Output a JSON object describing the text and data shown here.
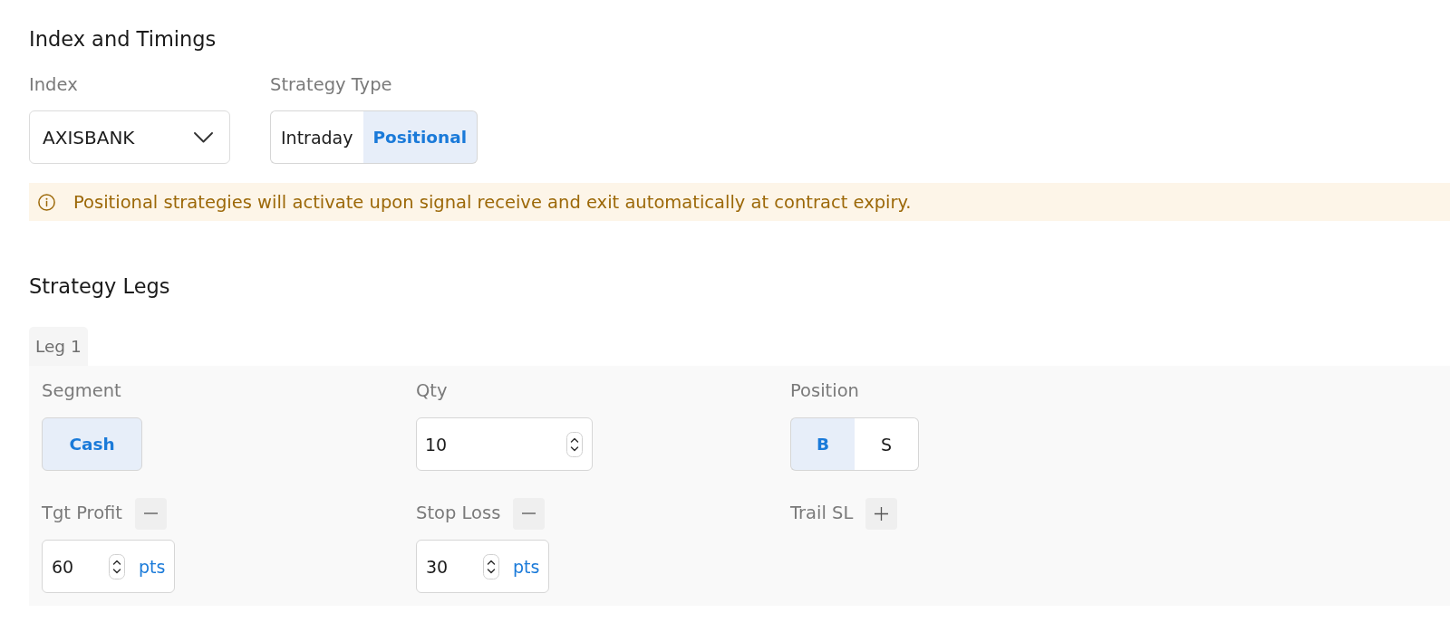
{
  "index_and_timings": {
    "title": "Index and Timings",
    "index": {
      "label": "Index",
      "value": "AXISBANK"
    },
    "strategy_type": {
      "label": "Strategy Type",
      "options": [
        {
          "label": "Intraday",
          "selected": false
        },
        {
          "label": "Positional",
          "selected": true
        }
      ]
    },
    "notice": {
      "text": "Positional strategies will activate upon signal receive and exit automatically at contract expiry."
    }
  },
  "strategy_legs": {
    "title": "Strategy Legs",
    "tabs": [
      {
        "label": "Leg 1",
        "selected": true
      }
    ],
    "fields": [
      {
        "kind": "choice",
        "label": "Segment",
        "options": [
          {
            "label": "Cash",
            "selected": true
          }
        ]
      },
      {
        "kind": "number",
        "label": "Qty",
        "value": "10"
      },
      {
        "kind": "choice",
        "label": "Position",
        "options": [
          {
            "label": "B",
            "selected": true
          },
          {
            "label": "S",
            "selected": false
          }
        ]
      },
      {
        "kind": "points",
        "label": "Tgt Profit",
        "enabled": true,
        "value": "60",
        "unit": "pts"
      },
      {
        "kind": "points",
        "label": "Stop Loss",
        "enabled": true,
        "value": "30",
        "unit": "pts"
      },
      {
        "kind": "points",
        "label": "Trail SL",
        "enabled": false
      }
    ]
  }
}
